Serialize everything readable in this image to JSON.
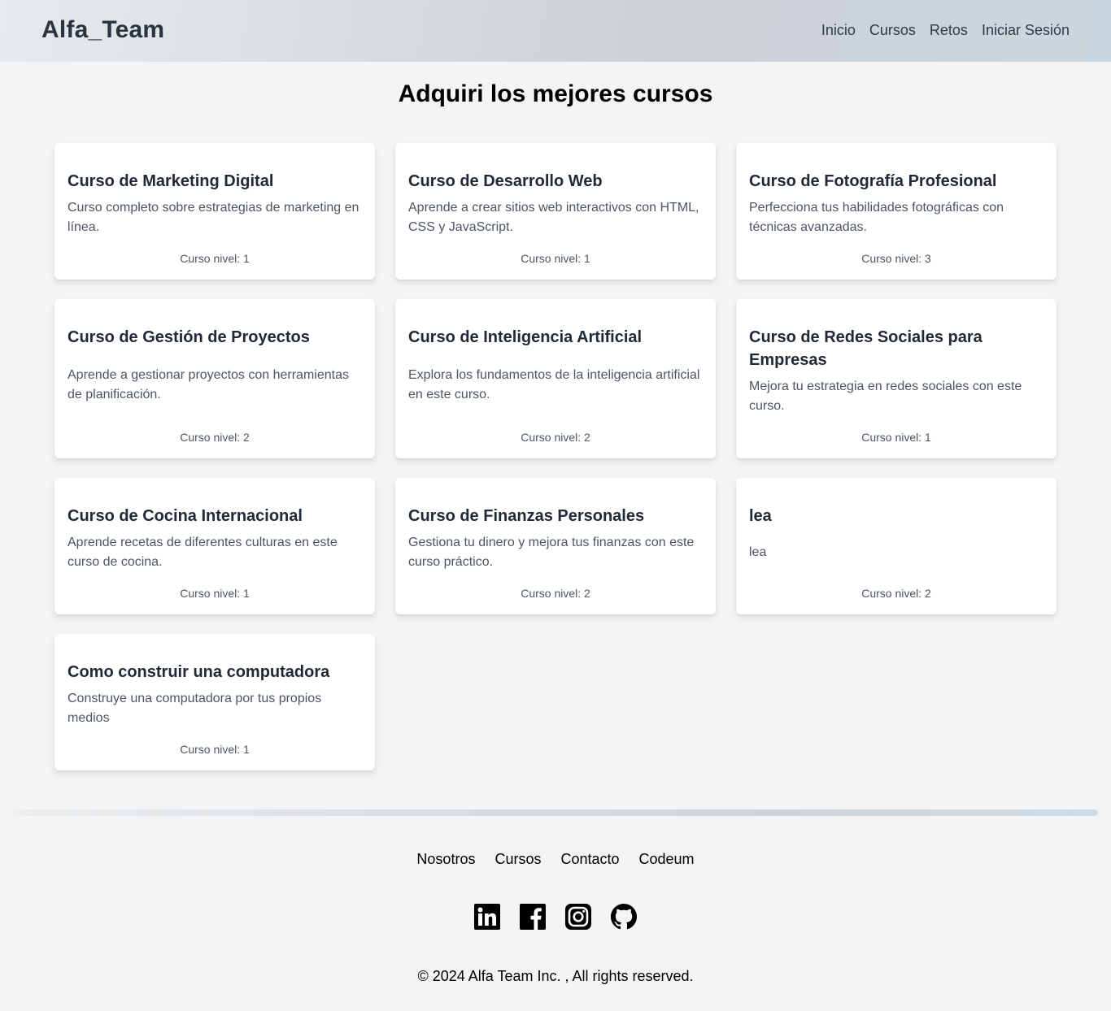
{
  "header": {
    "logo": "Alfa_Team",
    "nav": [
      "Inicio",
      "Cursos",
      "Retos",
      "Iniciar Sesión"
    ]
  },
  "page_title": "Adquiri los mejores cursos",
  "courses": [
    {
      "title": "Curso de Marketing Digital",
      "description": "Curso completo sobre estrategias de marketing en línea.",
      "level": "Curso nivel: 1"
    },
    {
      "title": "Curso de Desarrollo Web",
      "description": "Aprende a crear sitios web interactivos con HTML, CSS y JavaScript.",
      "level": "Curso nivel: 1"
    },
    {
      "title": "Curso de Fotografía Profesional",
      "description": "Perfecciona tus habilidades fotográficas con técnicas avanzadas.",
      "level": "Curso nivel: 3"
    },
    {
      "title": "Curso de Gestión de Proyectos",
      "description": "Aprende a gestionar proyectos con herramientas de planificación.",
      "level": "Curso nivel: 2"
    },
    {
      "title": "Curso de Inteligencia Artificial",
      "description": "Explora los fundamentos de la inteligencia artificial en este curso.",
      "level": "Curso nivel: 2"
    },
    {
      "title": "Curso de Redes Sociales para Empresas",
      "description": "Mejora tu estrategia en redes sociales con este curso.",
      "level": "Curso nivel: 1"
    },
    {
      "title": "Curso de Cocina Internacional",
      "description": "Aprende recetas de diferentes culturas en este curso de cocina.",
      "level": "Curso nivel: 1"
    },
    {
      "title": "Curso de Finanzas Personales",
      "description": "Gestiona tu dinero y mejora tus finanzas con este curso práctico.",
      "level": "Curso nivel: 2"
    },
    {
      "title": "lea",
      "description": "lea",
      "level": "Curso nivel: 2"
    },
    {
      "title": "Como construir una computadora",
      "description": "Construye una computadora por tus propios medios",
      "level": "Curso nivel: 1"
    }
  ],
  "footer": {
    "links": [
      "Nosotros",
      "Cursos",
      "Contacto",
      "Codeum"
    ],
    "social_icons": [
      "linkedin-icon",
      "facebook-icon",
      "instagram-icon",
      "github-icon"
    ],
    "copyright": "© 2024 Alfa Team Inc. , All rights reserved."
  }
}
